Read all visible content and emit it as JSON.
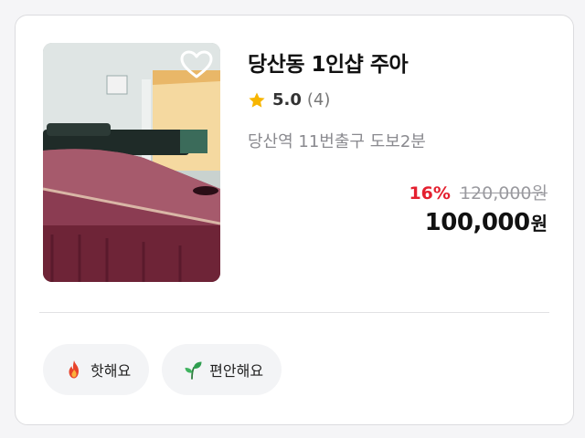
{
  "listing": {
    "title": "당산동 1인샵 주아",
    "rating": "5.0",
    "review_count": "(4)",
    "location": "당산역 11번출구 도보2분",
    "discount": "16%",
    "original_price": "120,000원",
    "price": "100,000",
    "currency": "원"
  },
  "tags": [
    {
      "label": "핫해요",
      "icon": "fire-icon"
    },
    {
      "label": "편안해요",
      "icon": "leaf-icon"
    }
  ],
  "colors": {
    "discount": "#e4202f",
    "star": "#f7b500",
    "tag_bg": "#f3f4f6",
    "leaf": "#2e9e4f",
    "flame": "#e8432b"
  }
}
